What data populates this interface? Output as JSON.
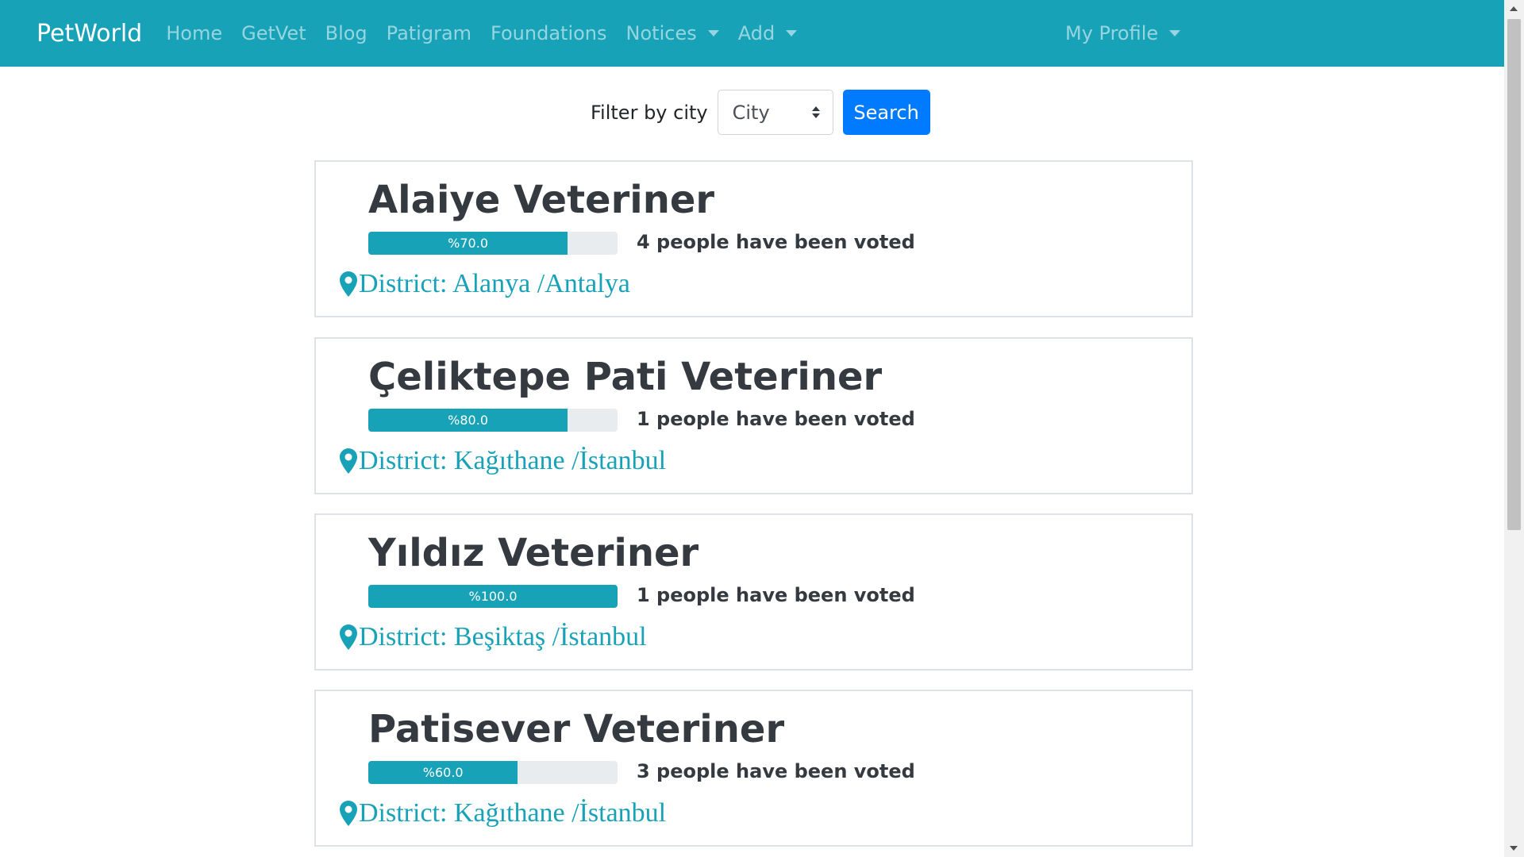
{
  "navbar": {
    "brand": "PetWorld",
    "items": [
      {
        "label": "Home"
      },
      {
        "label": "GetVet"
      },
      {
        "label": "Blog"
      },
      {
        "label": "Patigram"
      },
      {
        "label": "Foundations"
      },
      {
        "label": "Notices"
      },
      {
        "label": "Add"
      }
    ],
    "profile": "My Profile",
    "background": "#17a2b8"
  },
  "filter": {
    "label": "Filter by city",
    "city_selected": "City",
    "search_label": "Search"
  },
  "vets": [
    {
      "name": "Alaiye Veteriner",
      "rating_label": "%70.0",
      "rating": 0.8,
      "votes": "4 people have been voted",
      "district": "District: Alanya /Antalya"
    },
    {
      "name": "Çeliktepe Pati Veteriner",
      "rating_label": "%80.0",
      "rating": 0.8,
      "votes": "1 people have been voted",
      "district": "District: Kağıthane /İstanbul"
    },
    {
      "name": "Yıldız Veteriner",
      "rating_label": "%100.0",
      "rating": 1.0,
      "votes": "1 people have been voted",
      "district": "District: Beşiktaş /İstanbul"
    },
    {
      "name": "Patisever Veteriner",
      "rating_label": "%60.0",
      "rating": 0.6,
      "votes": "3 people have been voted",
      "district": "District: Kağıthane /İstanbul"
    }
  ],
  "colors": {
    "accent": "#17a2b8",
    "button": "#007bff"
  },
  "icons": {
    "district": "map-pin-icon"
  }
}
